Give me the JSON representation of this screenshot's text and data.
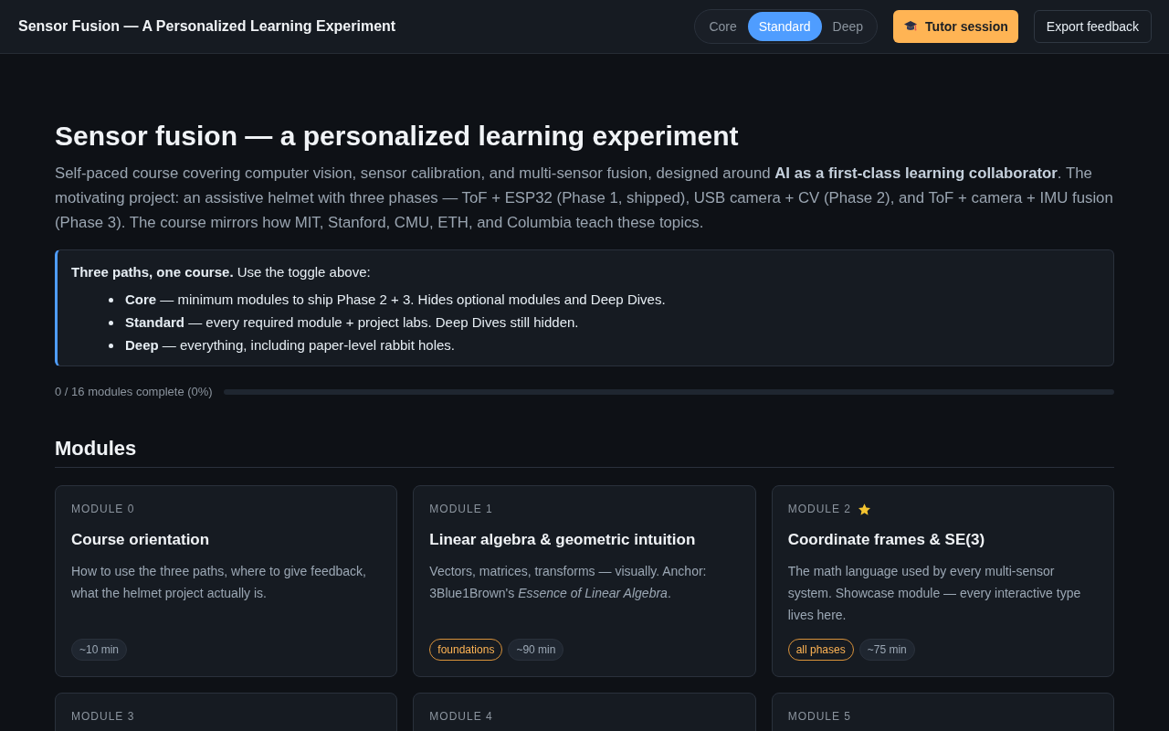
{
  "header": {
    "title": "Sensor Fusion — A Personalized Learning Experiment",
    "path_toggle": [
      {
        "label": "Core",
        "selected": false
      },
      {
        "label": "Standard",
        "selected": true
      },
      {
        "label": "Deep",
        "selected": false
      }
    ],
    "buttons": [
      {
        "label": "Tutor session",
        "kind": "primary"
      },
      {
        "label": "Export feedback",
        "kind": "secondary"
      }
    ]
  },
  "intro": {
    "title": "Sensor fusion — a personalized learning experiment",
    "description": "Self-paced course covering computer vision, sensor calibration, and multi-sensor fusion, designed around **AI as a first-class learning collaborator**. The motivating project: an assistive helmet with three phases — ToF + ESP32 (Phase 1, shipped), USB camera + CV (Phase 2), and ToF + camera + IMU fusion (Phase 3). The course mirrors how MIT, Stanford, CMU, ETH, and Columbia teach these topics."
  },
  "callout": {
    "lead": "**Three paths, one course.** Use the toggle above:",
    "items": [
      "**Core** — minimum modules to ship Phase 2 + 3. Hides optional modules and Deep Dives.",
      "**Standard** — every required module + project labs. Deep Dives still hidden.",
      "**Deep** — everything, including paper-level rabbit holes."
    ]
  },
  "progress": {
    "label": "0 / 16 modules complete (0%)",
    "level": 0
  },
  "modules_section": {
    "title": "Modules",
    "modules": [
      {
        "label": "MODULE 0",
        "featured": false,
        "title": "Course orientation",
        "description": "How to use the three paths, where to give feedback, what the helmet project actually is.",
        "tags": [
          {
            "label": "~10 min",
            "kind": "duration"
          }
        ]
      },
      {
        "label": "MODULE 1",
        "featured": false,
        "title": "Linear algebra & geometric intuition",
        "description": "Vectors, matrices, transforms — visually. Anchor: 3Blue1Brown's *Essence of Linear Algebra*.",
        "tags": [
          {
            "label": "foundations",
            "kind": "topic"
          },
          {
            "label": "~90 min",
            "kind": "duration"
          }
        ]
      },
      {
        "label": "MODULE 2",
        "featured": true,
        "title": "Coordinate frames & SE(3)",
        "description": "The math language used by every multi-sensor system. Showcase module — every interactive type lives here.",
        "tags": [
          {
            "label": "all phases",
            "kind": "topic"
          },
          {
            "label": "~75 min",
            "kind": "duration"
          }
        ]
      },
      {
        "label": "MODULE 3",
        "featured": false
      },
      {
        "label": "MODULE 4",
        "featured": false
      },
      {
        "label": "MODULE 5",
        "featured": false
      }
    ]
  }
}
